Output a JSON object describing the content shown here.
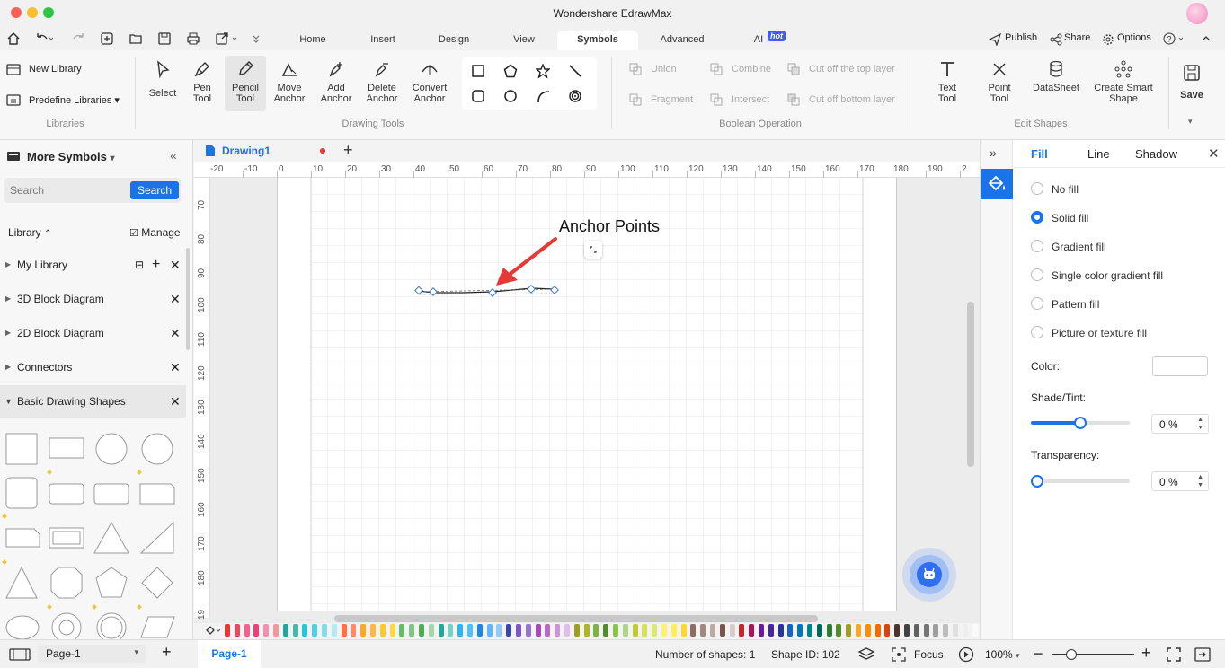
{
  "app": {
    "title": "Wondershare EdrawMax"
  },
  "menu": {
    "tabs": [
      {
        "label": "Home"
      },
      {
        "label": "Insert"
      },
      {
        "label": "Design"
      },
      {
        "label": "View"
      },
      {
        "label": "Symbols"
      },
      {
        "label": "Advanced"
      },
      {
        "label": "AI"
      }
    ],
    "ai_badge": "hot",
    "publish": "Publish",
    "share": "Share",
    "options": "Options"
  },
  "ribbon": {
    "libraries": {
      "new_library": "New Library",
      "predefine": "Predefine Libraries",
      "label": "Libraries"
    },
    "drawing_tools": {
      "select": "Select",
      "pen": "Pen Tool",
      "pencil": "Pencil Tool",
      "move_anchor": "Move Anchor",
      "add_anchor": "Add Anchor",
      "delete_anchor": "Delete Anchor",
      "convert_anchor": "Convert Anchor",
      "label": "Drawing Tools"
    },
    "boolean": {
      "union": "Union",
      "combine": "Combine",
      "cut_top": "Cut off the top layer",
      "fragment": "Fragment",
      "intersect": "Intersect",
      "cut_bottom": "Cut off bottom layer",
      "label": "Boolean Operation"
    },
    "edit_shapes": {
      "text_tool": "Text Tool",
      "point_tool": "Point Tool",
      "datasheet": "DataSheet",
      "smart_shape": "Create Smart Shape",
      "label": "Edit Shapes"
    },
    "save": "Save"
  },
  "left_panel": {
    "title": "More Symbols",
    "search_placeholder": "Search",
    "search_button": "Search",
    "library_label": "Library",
    "manage": "Manage",
    "libraries": [
      {
        "name": "My Library"
      },
      {
        "name": "3D Block Diagram"
      },
      {
        "name": "2D Block Diagram"
      },
      {
        "name": "Connectors"
      },
      {
        "name": "Basic Drawing Shapes"
      }
    ]
  },
  "document": {
    "tab_name": "Drawing1",
    "h_ruler": [
      "-20",
      "-10",
      "0",
      "10",
      "20",
      "30",
      "40",
      "50",
      "60",
      "70",
      "80",
      "90",
      "100",
      "110",
      "120",
      "130",
      "140",
      "150",
      "160",
      "170",
      "180",
      "190",
      "2"
    ],
    "v_ruler": [
      "70",
      "80",
      "90",
      "100",
      "110",
      "120",
      "130",
      "140",
      "150",
      "160",
      "170",
      "180",
      "19"
    ],
    "annotation": "Anchor Points"
  },
  "right_panel": {
    "tabs": [
      "Fill",
      "Line",
      "Shadow"
    ],
    "fill_options": [
      "No fill",
      "Solid fill",
      "Gradient fill",
      "Single color gradient fill",
      "Pattern fill",
      "Picture or texture fill"
    ],
    "selected_option": "Solid fill",
    "color_label": "Color:",
    "shade_label": "Shade/Tint:",
    "shade_value": "0 %",
    "shade_level": 0.5,
    "transparency_label": "Transparency:",
    "transparency_value": "0 %",
    "transparency_level": 0
  },
  "palette": [
    "#e53935",
    "#e84a5f",
    "#f06292",
    "#ec407a",
    "#f48fb1",
    "#ef9a9a",
    "#26a69a",
    "#4db6ac",
    "#26c6da",
    "#4dd0e1",
    "#80deea",
    "#b2ebf2",
    "#ff7043",
    "#ff8a65",
    "#ffa726",
    "#ffb74d",
    "#ffca28",
    "#ffd54f",
    "#66bb6a",
    "#81c784",
    "#4caf50",
    "#a5d6a7",
    "#26a69a",
    "#80cbc4",
    "#29b6f6",
    "#4fc3f7",
    "#1e88e5",
    "#64b5f6",
    "#90caf9",
    "#3949ab",
    "#7e57c2",
    "#9575cd",
    "#ab47bc",
    "#ba68c8",
    "#ce93d8",
    "#e1bee7",
    "#9e9d24",
    "#afb42b",
    "#7cb342",
    "#558b2f",
    "#8bc34a",
    "#aed581",
    "#c0ca33",
    "#d4e157",
    "#dce775",
    "#fff176",
    "#ffee58",
    "#fdd835",
    "#8d6e63",
    "#a1887f",
    "#bcaaa4",
    "#795548",
    "#d7ccc8",
    "#c62828",
    "#ad1457",
    "#6a1b9a",
    "#4527a0",
    "#283593",
    "#1565c0",
    "#0277bd",
    "#00838f",
    "#00695c",
    "#2e7d32",
    "#558b2f",
    "#9e9d24",
    "#f9a825",
    "#ff8f00",
    "#ef6c00",
    "#d84315",
    "#4e342e",
    "#424242",
    "#616161",
    "#757575",
    "#9e9e9e",
    "#bdbdbd",
    "#e0e0e0",
    "#eeeeee",
    "#fafafa"
  ],
  "status": {
    "page_selector": "Page-1",
    "page_tab": "Page-1",
    "num_shapes": "Number of shapes: 1",
    "shape_id": "Shape ID: 102",
    "focus": "Focus",
    "zoom": "100%"
  }
}
